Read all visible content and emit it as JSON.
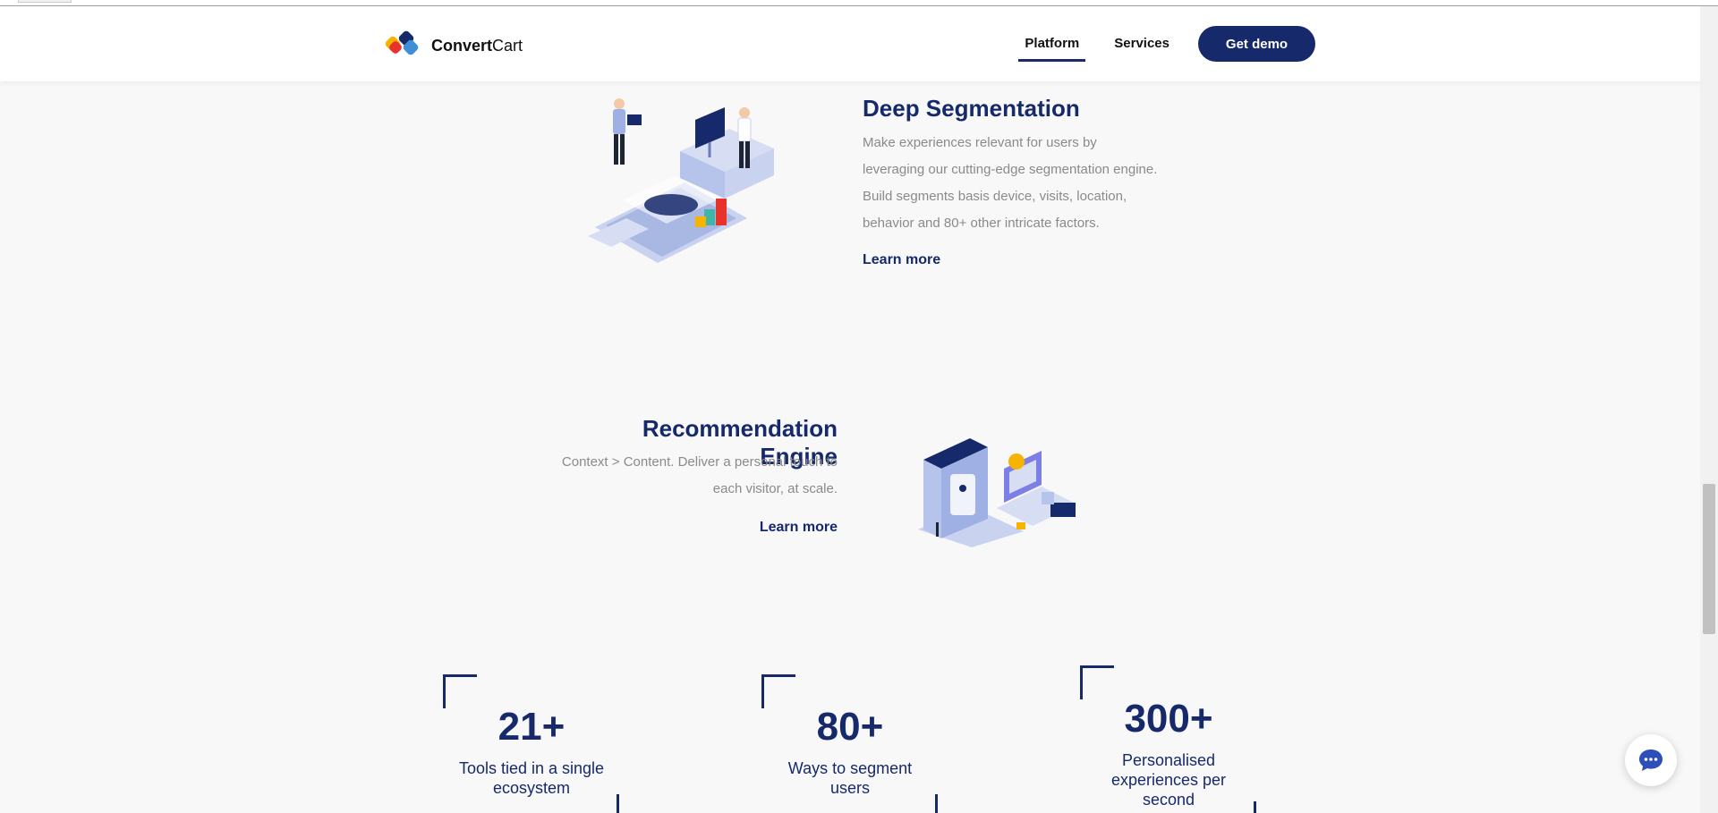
{
  "header": {
    "brand_bold": "Convert",
    "brand_light": "Cart",
    "nav": [
      {
        "label": "Platform",
        "active": true
      },
      {
        "label": "Services",
        "active": false
      }
    ],
    "cta_label": "Get demo"
  },
  "features": [
    {
      "title": "Deep Segmentation",
      "description_lines": [
        "Make experiences relevant for users by",
        "leveraging our cutting-edge segmentation engine.",
        "Build segments basis device, visits, location,",
        "behavior and 80+ other intricate factors."
      ],
      "link_label": "Learn more",
      "illustration": "segmentation-illustration"
    },
    {
      "title": "Recommendation Engine",
      "description_lines": [
        "Context > Content. Deliver a personal touch to",
        "each visitor, at scale."
      ],
      "link_label": "Learn more",
      "illustration": "recommendation-illustration"
    }
  ],
  "stats": [
    {
      "value": "21+",
      "label_lines": [
        "Tools tied in a single",
        "ecosystem"
      ]
    },
    {
      "value": "80+",
      "label_lines": [
        "Ways to segment",
        "users"
      ]
    },
    {
      "value": "300+",
      "label_lines": [
        "Personalised",
        "experiences per",
        "second"
      ]
    }
  ],
  "icons": {
    "chat": "chat-bubble-icon",
    "logo": "convertcart-logo-icon"
  },
  "colors": {
    "brand_navy": "#16296b",
    "background": "#f8f8f9",
    "muted_text": "#8a8a8a"
  }
}
